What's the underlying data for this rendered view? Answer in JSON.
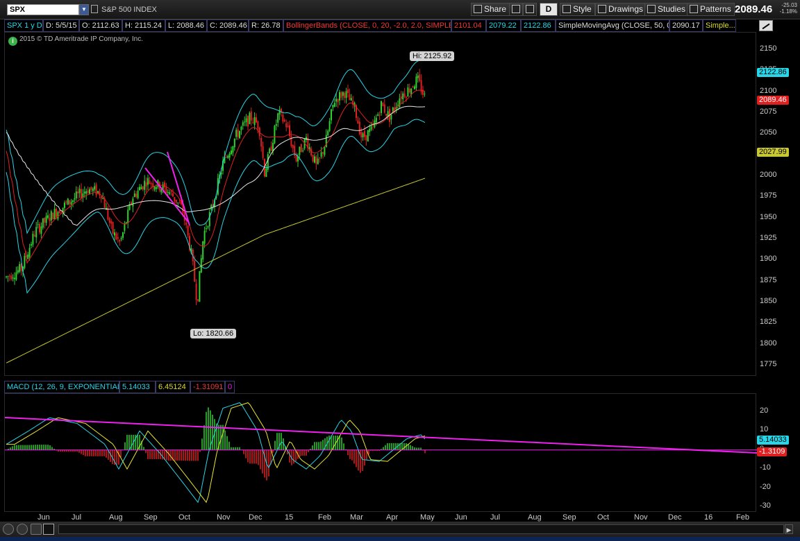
{
  "toolbar": {
    "symbol": "SPX",
    "symbol_name": "S&P 500 INDEX",
    "share_label": "Share",
    "period_label": "D",
    "style_label": "Style",
    "drawings_label": "Drawings",
    "studies_label": "Studies",
    "patterns_label": "Patterns",
    "last_price": "2089.46",
    "net_change": "-25.03",
    "pct_change": "-1.18%"
  },
  "study_header": {
    "chart_spec": "SPX 1 y D",
    "date": "D: 5/5/15",
    "open": "O: 2112.63",
    "high": "H: 2115.24",
    "low": "L: 2088.46",
    "close": "C: 2089.46",
    "range": "R: 26.78",
    "bollinger_name": "BollingerBands (CLOSE, 0, 20, -2.0, 2.0, SIMPLE)",
    "bollinger_mid": "2101.04",
    "bollinger_low": "2079.22",
    "bollinger_high": "2122.86",
    "sma_name": "SimpleMovingAvg (CLOSE, 50, 0)",
    "sma_value": "2090.17",
    "more_label": "Simple..."
  },
  "copyright": "2015 © TD Ameritrade IP Company, Inc.",
  "price_axis": {
    "ticks": [
      "2150",
      "2125",
      "2100",
      "2075",
      "2050",
      "2025",
      "2000",
      "1975",
      "1950",
      "1925",
      "1900",
      "1875",
      "1850",
      "1825",
      "1800",
      "1775"
    ],
    "labels": [
      {
        "text": "2122.86",
        "bg": "#27d6e8",
        "fg": "#000"
      },
      {
        "text": "2089.46",
        "bg": "#e02020",
        "fg": "#fff"
      },
      {
        "text": "2027.99",
        "bg": "#c8c832",
        "fg": "#000"
      }
    ]
  },
  "callouts": {
    "high": "Hi: 2125.92",
    "low": "Lo: 1820.66"
  },
  "macd_header": {
    "name": "MACD (12, 26, 9, EXPONENTIAL)",
    "value": "5.14033",
    "avg": "6.45124",
    "diff": "-1.31091",
    "zero": "0"
  },
  "macd_axis": {
    "ticks": [
      "20",
      "10",
      "0",
      "-10",
      "-20",
      "-30"
    ],
    "labels": [
      {
        "text": "5.14033",
        "bg": "#27d6e8",
        "fg": "#000"
      },
      {
        "text": "-1.3109",
        "bg": "#e02020",
        "fg": "#fff"
      }
    ]
  },
  "time_axis": [
    "Jun",
    "Jul",
    "Aug",
    "Sep",
    "Oct",
    "Nov",
    "Dec",
    "15",
    "Feb",
    "Mar",
    "Apr",
    "May",
    "Jun",
    "Jul",
    "Aug",
    "Sep",
    "Oct",
    "Nov",
    "Dec",
    "16",
    "Feb"
  ],
  "colors": {
    "bollinger": "#27d6e8",
    "bb_mid": "#e02020",
    "sma50": "#e8e8e8",
    "sma200": "#c8c832",
    "up": "#2fd12f",
    "down": "#e02020",
    "trendline": "#f020f0"
  },
  "chart_data": {
    "type": "candlestick",
    "price_ylim": [
      1775,
      2150
    ],
    "high": 2125.92,
    "low": 1820.66,
    "last": 2089.46,
    "macd_ylim": [
      -30,
      20
    ]
  }
}
